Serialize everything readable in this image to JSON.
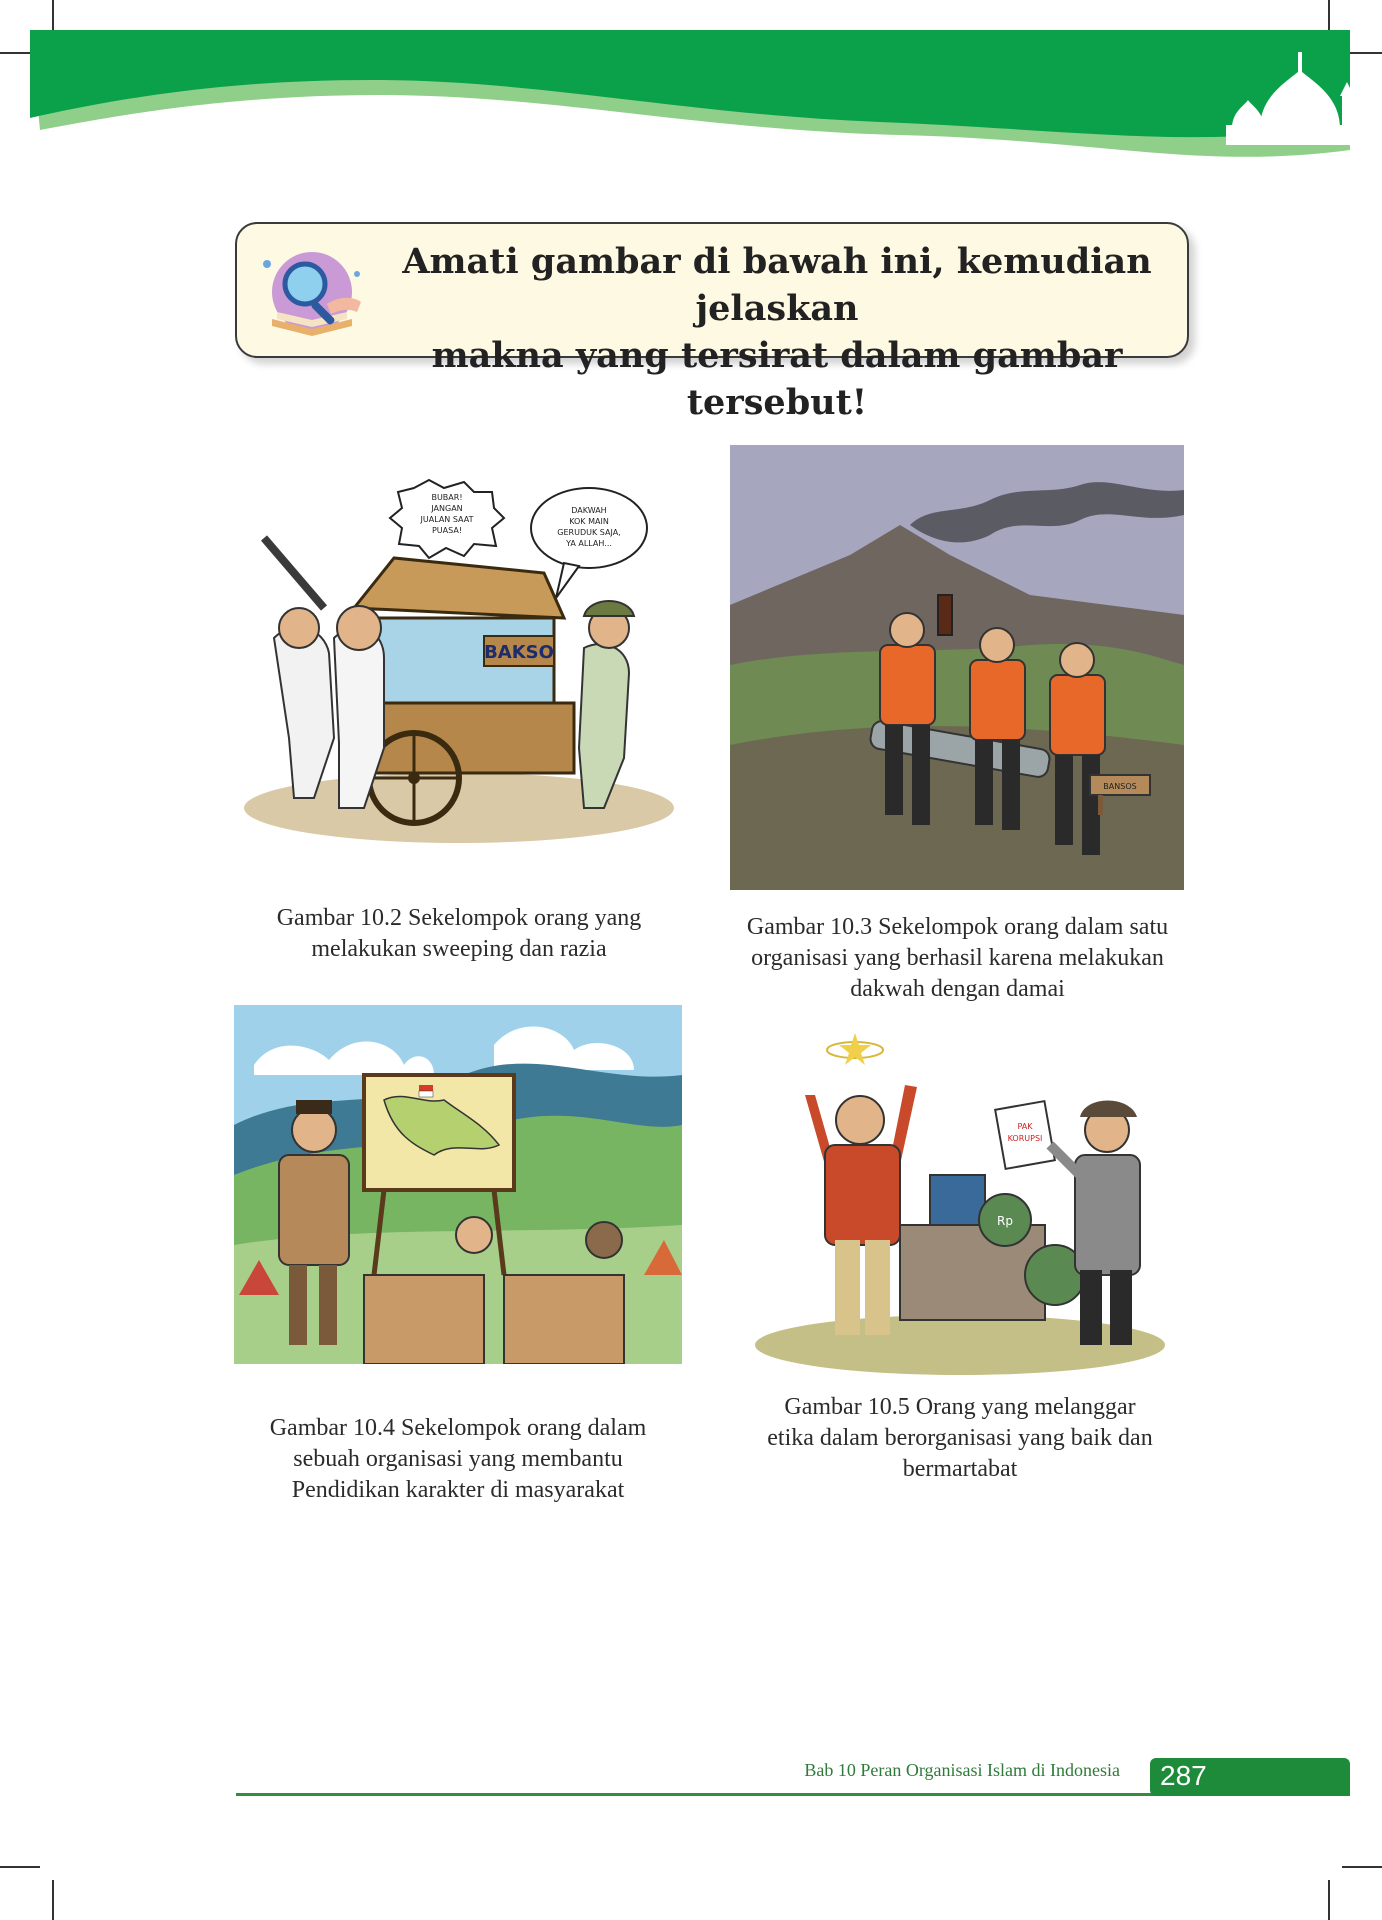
{
  "instruction": {
    "line1": "Amati gambar di bawah ini, kemudian jelaskan",
    "line2": "makna yang tersirat dalam gambar tersebut!"
  },
  "figures": [
    {
      "caption_lines": [
        "Gambar 10.2 Sekelompok orang yang",
        "melakukan sweeping dan razia"
      ],
      "speech1": [
        "BUBAR!",
        "JANGAN",
        "JUALAN SAAT",
        "PUASA!"
      ],
      "speech2": [
        "DAKWAH",
        "KOK MAIN",
        "GERUDUK SAJA,",
        "YA ALLAH..."
      ],
      "cart_label": "BAKSO"
    },
    {
      "caption_lines": [
        "Gambar 10.3 Sekelompok orang dalam satu",
        "organisasi yang berhasil karena melakukan",
        "dakwah dengan damai"
      ],
      "sign_label": "BANSOS"
    },
    {
      "caption_lines": [
        "Gambar 10.4 Sekelompok orang dalam",
        "sebuah organisasi yang membantu",
        "Pendidikan karakter di masyarakat"
      ]
    },
    {
      "caption_lines": [
        "Gambar 10.5 Orang yang melanggar",
        "etika dalam berorganisasi yang baik dan",
        "bermartabat"
      ],
      "paper_label": [
        "PAK",
        "KORUPSI"
      ],
      "bag_label": "Rp"
    }
  ],
  "footer": {
    "chapter": "Bab 10 Peran Organisasi Islam di Indonesia",
    "page_number": "287"
  },
  "colors": {
    "header_green": "#0ba14b",
    "header_light_green": "#8fcf8a",
    "footer_green": "#1e8b3a",
    "box_fill": "#fdf9e3"
  }
}
